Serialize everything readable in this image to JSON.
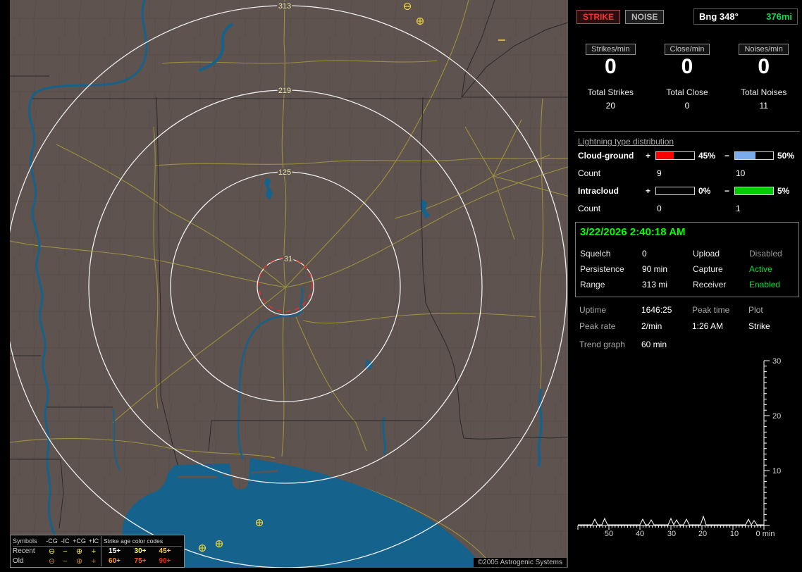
{
  "colors": {
    "accent_green": "#00ff00",
    "strike_red": "#ff3030",
    "gauge_red": "#ff0000",
    "gauge_blue": "#7aabec",
    "gauge_green": "#00cc00",
    "map_land": "#5e534e",
    "map_water": "#15628c",
    "ring_white": "#f0f0f0",
    "road_yellow": "#a4973e"
  },
  "map": {
    "rings": [
      {
        "label": "313"
      },
      {
        "label": "219"
      },
      {
        "label": "125"
      },
      {
        "label": "31"
      }
    ],
    "copyright": "©2005 Astrogenic Systems",
    "legend": {
      "symbols_header": "Symbols",
      "columns": [
        "-CG",
        "-IC",
        "+CG",
        "+IC"
      ],
      "glyphs": [
        "⊖",
        "−",
        "⊕",
        "+"
      ],
      "age_header": "Strike age color codes",
      "rows": [
        {
          "label": "Recent",
          "ages": [
            "15+",
            "30+",
            "45+"
          ]
        },
        {
          "label": "Old",
          "ages": [
            "60+",
            "75+",
            "90+"
          ]
        }
      ]
    }
  },
  "panel": {
    "strike_button": "STRIKE",
    "noise_button": "NOISE",
    "bearing": "Bng 348°",
    "distance": "376mi",
    "rates": [
      {
        "label": "Strikes/min",
        "value": "0"
      },
      {
        "label": "Close/min",
        "value": "0"
      },
      {
        "label": "Noises/min",
        "value": "0"
      }
    ],
    "totals": [
      {
        "label": "Total Strikes",
        "value": "20"
      },
      {
        "label": "Total Close",
        "value": "0"
      },
      {
        "label": "Total Noises",
        "value": "11"
      }
    ],
    "distribution": {
      "title": "Lightning type distribution",
      "cloud_ground": {
        "label": "Cloud-ground",
        "plus_sign": "+",
        "plus_pct": "45%",
        "plus_fill": 47,
        "minus_sign": "−",
        "minus_pct": "50%",
        "minus_fill": 53
      },
      "cloud_ground_count": {
        "label": "Count",
        "plus": "9",
        "minus": "10"
      },
      "intracloud": {
        "label": "Intracloud",
        "plus_sign": "+",
        "plus_pct": "0%",
        "plus_fill": 0,
        "minus_sign": "−",
        "minus_pct": "5%",
        "minus_fill": 100
      },
      "intracloud_count": {
        "label": "Count",
        "plus": "0",
        "minus": "1"
      }
    },
    "timestamp": "3/22/2026 2:40:18 AM",
    "settings": {
      "squelch_label": "Squelch",
      "squelch": "0",
      "persistence_label": "Persistence",
      "persistence": "90 min",
      "range_label": "Range",
      "range": "313 mi",
      "upload_label": "Upload",
      "upload": "Disabled",
      "capture_label": "Capture",
      "capture": "Active",
      "receiver_label": "Receiver",
      "receiver": "Enabled"
    },
    "stats": {
      "uptime_label": "Uptime",
      "uptime": "1646:25",
      "peak_time_label": "Peak time",
      "plot_label": "Plot",
      "peak_rate_label": "Peak rate",
      "peak_rate": "2/min",
      "peak_time": "1:26 AM",
      "plot": "Strike",
      "trend_label": "Trend graph",
      "trend_value": "60 min"
    },
    "trend": {
      "y_ticks": [
        "30",
        "20",
        "10"
      ],
      "x_ticks": [
        "50",
        "40",
        "30",
        "20",
        "10",
        "0 min"
      ]
    }
  }
}
